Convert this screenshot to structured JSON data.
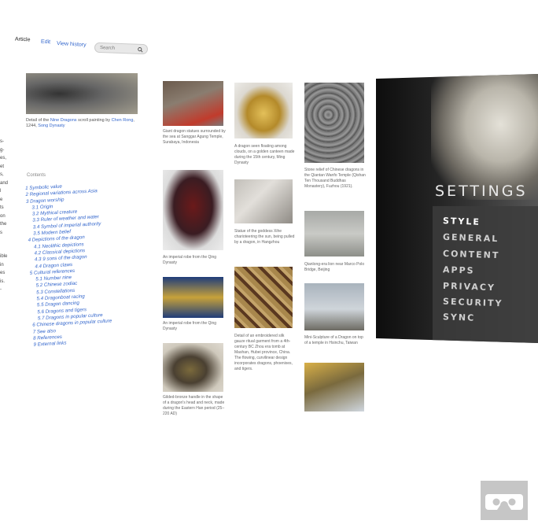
{
  "header": {
    "tabs": [
      {
        "label": "Article"
      },
      {
        "label": "Edit"
      },
      {
        "label": "View history"
      }
    ],
    "search": {
      "placeholder": "Search"
    }
  },
  "left_fragment": [
    "s-",
    "g-",
    "es,",
    "et",
    "s,",
    "and",
    "l",
    "e",
    "ts",
    "on",
    "the",
    "s",
    "ible",
    "in",
    "es",
    "is.",
    "- "
  ],
  "lead_image": {
    "caption_pre": "Detail of the",
    "caption_link1": "Nine Dragons",
    "caption_mid": "scroll painting by",
    "caption_link2": "Chen Rong",
    "caption_post": ", 1244,",
    "caption_link3": "Song Dynasty"
  },
  "contents": {
    "heading": "Contents",
    "items": [
      "1 Symbolic value",
      "2 Regional variations across Asia",
      "3 Dragon worship",
      "3.1 Origin",
      "3.2 Mythical creature",
      "3.3 Ruler of weather and water",
      "3.4 Symbol of imperial authority",
      "3.5 Modern belief",
      "4 Depictions of the dragon",
      "4.1 Neolithic depictions",
      "4.2 Classical depictions",
      "4.3 9 sons of the dragon",
      "4.4 Dragon claws",
      "5 Cultural references",
      "5.1 Number nine",
      "5.2 Chinese zodiac",
      "5.3 Constellations",
      "5.4 Dragonboat racing",
      "5.5 Dragon dancing",
      "5.6 Dragons and tigers",
      "5.7 Dragons in popular culture",
      "6 Chinese dragons in popular culture",
      "7 See also",
      "8 References",
      "9 External links"
    ]
  },
  "gallery": {
    "col1": [
      {
        "cap": "Giant dragon statues surrounded by the sea at Sanggar Agung Temple, Surabaya, Indonesia"
      },
      {
        "cap": "An imperial robe from the Qing Dynasty"
      },
      {
        "cap": "An imperial robe from the Qing Dynasty"
      },
      {
        "cap": "Gilded-bronze handle in the shape of a dragon's head and neck, made during the Eastern Han period (25–220 AD)"
      }
    ],
    "col2": [
      {
        "cap": "A dragon seen floating among clouds, on a golden canteen made during the 15th century, Ming Dynasty"
      },
      {
        "cap": "Statue of the goddess Xihe charioteering the sun, being pulled by a dragon, in Hangzhou"
      },
      {
        "cap": "Detail of an embroidered silk gauze ritual garment from a 4th-century BC Zhou era tomb at Mashan, Hubei province, China. The flowing, curvilinear design incorporates dragons, phoenixes, and tigers."
      }
    ],
    "col3": [
      {
        "cap": "Stone relief of Chinese dragons in the Qiantan Wanfo Temple (Qishan Ten Thousand Buddhas Monastery), Fuzhou (1921)."
      },
      {
        "cap": "Qianlong-era lion near Marco Polo Bridge, Beijing"
      },
      {
        "cap": "Mini-Sculpture of a Dragon on top of a temple in Hsinchu, Taiwan"
      },
      {
        "cap": ""
      }
    ]
  },
  "settings": {
    "title": "SETTINGS",
    "items": [
      {
        "label": "STYLE",
        "active": true
      },
      {
        "label": "GENERAL",
        "active": false
      },
      {
        "label": "CONTENT",
        "active": false
      },
      {
        "label": "APPS",
        "active": false
      },
      {
        "label": "PRIVACY",
        "active": false
      },
      {
        "label": "SECURITY",
        "active": false
      },
      {
        "label": "SYNC",
        "active": false
      }
    ]
  },
  "vr_button": {
    "icon": "cardboard-vr-icon"
  }
}
